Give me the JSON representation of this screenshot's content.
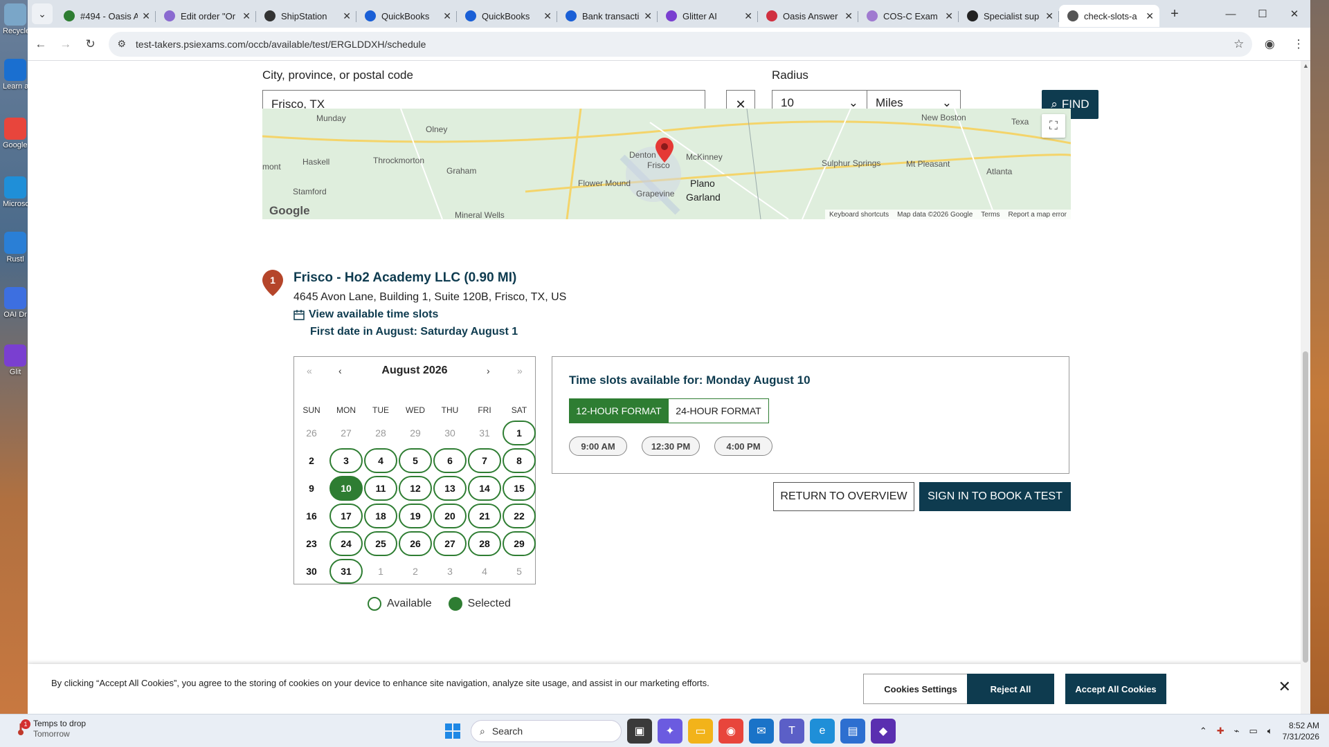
{
  "desktop": {
    "icons": [
      {
        "label": "Recycle",
        "color": "#7aa6c8"
      },
      {
        "label": "Learn about this picture",
        "color": "#1a6fd0"
      },
      {
        "label": "Google Chrome",
        "color": "#e8453c"
      },
      {
        "label": "Microsoft Edge",
        "color": "#1f8fd8"
      },
      {
        "label": "Rustl",
        "color": "#2a7fd6"
      },
      {
        "label": "OAI Dr",
        "color": "#3d6fe0"
      },
      {
        "label": "Glit",
        "color": "#7a3fd0"
      }
    ]
  },
  "browser": {
    "tabs": [
      {
        "title": "#494 - Oasis A",
        "icon": "phone-icon",
        "color": "#2e7d32"
      },
      {
        "title": "Edit order \"Or",
        "icon": "edit-icon",
        "color": "#8a6ad0"
      },
      {
        "title": "ShipStation",
        "icon": "gear-icon",
        "color": "#333333"
      },
      {
        "title": "QuickBooks",
        "icon": "quickbooks-icon",
        "color": "#1a5fd6"
      },
      {
        "title": "QuickBooks",
        "icon": "quickbooks-icon",
        "color": "#1a5fd6"
      },
      {
        "title": "Bank transacti",
        "icon": "quickbooks-icon",
        "color": "#1a5fd6"
      },
      {
        "title": "Glitter AI",
        "icon": "glitter-icon",
        "color": "#7a3fd0"
      },
      {
        "title": "Oasis Answer",
        "icon": "oasis-icon",
        "color": "#d03040"
      },
      {
        "title": "COS-C Exam (",
        "icon": "cos-icon",
        "color": "#a07ad0"
      },
      {
        "title": "Specialist sup",
        "icon": "specialist-icon",
        "color": "#222222"
      },
      {
        "title": "check-slots-a",
        "icon": "psi-icon",
        "color": "#555555",
        "active": true
      }
    ],
    "url": "test-takers.psiexams.com/occb/available/test/ERGLDDXH/schedule"
  },
  "search": {
    "location_label": "City, province, or postal code",
    "location_value": "Frisco, TX",
    "radius_label": "Radius",
    "radius_value": "10",
    "unit_value": "Miles",
    "find_label": "FIND"
  },
  "map": {
    "cities": [
      {
        "name": "Munday"
      },
      {
        "name": "Olney"
      },
      {
        "name": "Haskell"
      },
      {
        "name": "Throckmorton"
      },
      {
        "name": "Graham"
      },
      {
        "name": "Stamford"
      },
      {
        "name": "Mineral Wells"
      },
      {
        "name": "Denton"
      },
      {
        "name": "McKinney"
      },
      {
        "name": "Frisco"
      },
      {
        "name": "Flower Mound"
      },
      {
        "name": "Plano"
      },
      {
        "name": "Grapevine"
      },
      {
        "name": "Garland"
      },
      {
        "name": "New Boston"
      },
      {
        "name": "Sulphur Springs"
      },
      {
        "name": "Mt Pleasant"
      },
      {
        "name": "Atlanta"
      },
      {
        "name": "Texa"
      },
      {
        "name": "mont"
      }
    ],
    "footer": [
      "Keyboard shortcuts",
      "Map data ©2026 Google",
      "Terms",
      "Report a map error"
    ],
    "logo": "Google"
  },
  "location": {
    "number": "1",
    "title": "Frisco - Ho2 Academy LLC (0.90 MI)",
    "address": "4645 Avon Lane, Building 1, Suite 120B, Frisco, TX, US",
    "view_slots_label": "View available time slots",
    "first_date": "First date in August: Saturday August 1"
  },
  "calendar": {
    "month_label": "August 2026",
    "nav": {
      "first": "«",
      "prev": "‹",
      "next": "›",
      "last": "»"
    },
    "weekdays": [
      "SUN",
      "MON",
      "TUE",
      "WED",
      "THU",
      "FRI",
      "SAT"
    ],
    "weeks": [
      [
        {
          "d": "26",
          "s": "out"
        },
        {
          "d": "27",
          "s": "out"
        },
        {
          "d": "28",
          "s": "out"
        },
        {
          "d": "29",
          "s": "out"
        },
        {
          "d": "30",
          "s": "out"
        },
        {
          "d": "31",
          "s": "out"
        },
        {
          "d": "1",
          "s": "avail"
        }
      ],
      [
        {
          "d": "2",
          "s": "none"
        },
        {
          "d": "3",
          "s": "avail"
        },
        {
          "d": "4",
          "s": "avail"
        },
        {
          "d": "5",
          "s": "avail"
        },
        {
          "d": "6",
          "s": "avail"
        },
        {
          "d": "7",
          "s": "avail"
        },
        {
          "d": "8",
          "s": "avail"
        }
      ],
      [
        {
          "d": "9",
          "s": "none"
        },
        {
          "d": "10",
          "s": "sel"
        },
        {
          "d": "11",
          "s": "avail"
        },
        {
          "d": "12",
          "s": "avail"
        },
        {
          "d": "13",
          "s": "avail"
        },
        {
          "d": "14",
          "s": "avail"
        },
        {
          "d": "15",
          "s": "avail"
        }
      ],
      [
        {
          "d": "16",
          "s": "none"
        },
        {
          "d": "17",
          "s": "avail"
        },
        {
          "d": "18",
          "s": "avail"
        },
        {
          "d": "19",
          "s": "avail"
        },
        {
          "d": "20",
          "s": "avail"
        },
        {
          "d": "21",
          "s": "avail"
        },
        {
          "d": "22",
          "s": "avail"
        }
      ],
      [
        {
          "d": "23",
          "s": "none"
        },
        {
          "d": "24",
          "s": "avail"
        },
        {
          "d": "25",
          "s": "avail"
        },
        {
          "d": "26",
          "s": "avail"
        },
        {
          "d": "27",
          "s": "avail"
        },
        {
          "d": "28",
          "s": "avail"
        },
        {
          "d": "29",
          "s": "avail"
        }
      ],
      [
        {
          "d": "30",
          "s": "none"
        },
        {
          "d": "31",
          "s": "avail"
        },
        {
          "d": "1",
          "s": "out"
        },
        {
          "d": "2",
          "s": "out"
        },
        {
          "d": "3",
          "s": "out"
        },
        {
          "d": "4",
          "s": "out"
        },
        {
          "d": "5",
          "s": "out"
        }
      ]
    ],
    "legend_available": "Available",
    "legend_selected": "Selected"
  },
  "slots": {
    "title": "Time slots available for: Monday August 10",
    "format_12": "12-HOUR FORMAT",
    "format_24": "24-HOUR FORMAT",
    "times": [
      "9:00 AM",
      "12:30 PM",
      "4:00 PM"
    ]
  },
  "actions": {
    "return_label": "RETURN TO OVERVIEW",
    "signin_label": "SIGN IN TO BOOK A TEST"
  },
  "cookie": {
    "text": "By clicking “Accept All Cookies”, you agree to the storing of cookies on your device to enhance site navigation, analyze site usage, and assist in our marketing efforts.",
    "settings": "Cookies Settings",
    "reject": "Reject All",
    "accept": "Accept All Cookies"
  },
  "taskbar": {
    "weather_title": "Temps to drop",
    "weather_sub": "Tomorrow",
    "weather_badge": "1",
    "search_placeholder": "Search",
    "time": "8:52 AM",
    "date": "7/31/2026"
  },
  "colors": {
    "accent": "#0e3b4f",
    "available": "#2e7d32",
    "marker": "#b5452a"
  }
}
